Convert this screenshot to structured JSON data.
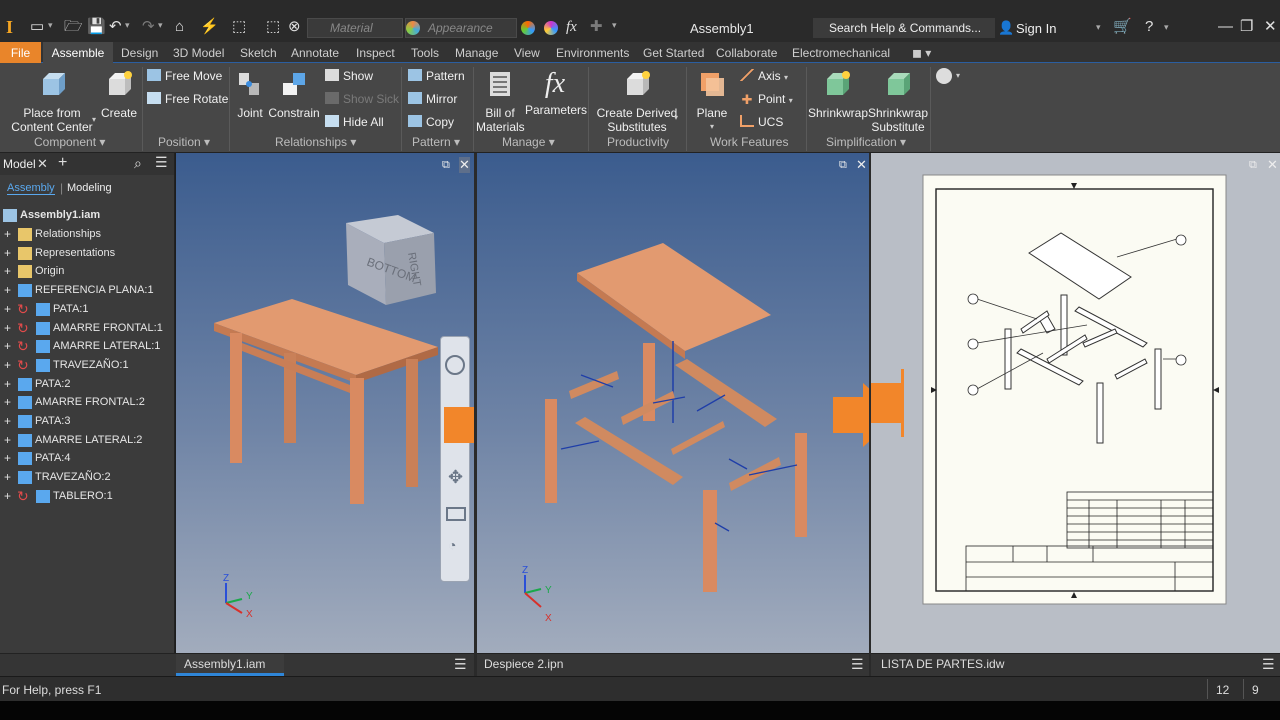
{
  "titlebar": {
    "material_placeholder": "Material",
    "appearance_placeholder": "Appearance",
    "document_title": "Assembly1",
    "search_placeholder": "Search Help & Commands...",
    "sign_in": "Sign In"
  },
  "menu": {
    "items": [
      "File",
      "Assemble",
      "Design",
      "3D Model",
      "Sketch",
      "Annotate",
      "Inspect",
      "Tools",
      "Manage",
      "View",
      "Environments",
      "Get Started",
      "Collaborate",
      "Electromechanical"
    ]
  },
  "ribbon": {
    "component": {
      "place_label": "Place from\nContent Center",
      "create_label": "Create",
      "panel": "Component"
    },
    "position": {
      "free_move": "Free Move",
      "free_rotate": "Free Rotate",
      "panel": "Position"
    },
    "relationships": {
      "joint": "Joint",
      "constrain": "Constrain",
      "show": "Show",
      "show_sick": "Show Sick",
      "hide_all": "Hide All",
      "panel": "Relationships"
    },
    "pattern": {
      "pattern": "Pattern",
      "mirror": "Mirror",
      "copy": "Copy",
      "panel": "Pattern"
    },
    "manage": {
      "bom": "Bill of\nMaterials",
      "parameters": "Parameters",
      "panel": "Manage"
    },
    "productivity": {
      "derived": "Create Derived\nSubstitutes",
      "panel": "Productivity"
    },
    "work_features": {
      "plane": "Plane",
      "axis": "Axis",
      "point": "Point",
      "ucs": "UCS",
      "panel": "Work Features"
    },
    "simplification": {
      "shrinkwrap": "Shrinkwrap",
      "shrinkwrap_sub": "Shrinkwrap\nSubstitute",
      "panel": "Simplification"
    }
  },
  "browser": {
    "tab_model": "Model",
    "sub_assembly": "Assembly",
    "sub_modeling": "Modeling",
    "root": "Assembly1.iam",
    "items": [
      {
        "label": "Relationships",
        "icon": "folder"
      },
      {
        "label": "Representations",
        "icon": "folder"
      },
      {
        "label": "Origin",
        "icon": "folder"
      },
      {
        "label": "REFERENCIA PLANA:1",
        "icon": "part"
      },
      {
        "label": "PATA:1",
        "icon": "part-refresh"
      },
      {
        "label": "AMARRE FRONTAL:1",
        "icon": "part-refresh"
      },
      {
        "label": "AMARRE LATERAL:1",
        "icon": "part-refresh"
      },
      {
        "label": "TRAVEZAÑO:1",
        "icon": "part-refresh"
      },
      {
        "label": "PATA:2",
        "icon": "part"
      },
      {
        "label": "AMARRE FRONTAL:2",
        "icon": "part"
      },
      {
        "label": "PATA:3",
        "icon": "part"
      },
      {
        "label": "AMARRE LATERAL:2",
        "icon": "part"
      },
      {
        "label": "PATA:4",
        "icon": "part"
      },
      {
        "label": "TRAVEZAÑO:2",
        "icon": "part"
      },
      {
        "label": "TABLERO:1",
        "icon": "part-refresh"
      }
    ]
  },
  "viewcube": {
    "face_top": "BOTTOM",
    "face_right": "RIGHT"
  },
  "tabs": {
    "view1": "Assembly1.iam",
    "view2": "Despiece 2.ipn",
    "view3": "LISTA DE PARTES.idw"
  },
  "status": {
    "help": "For Help, press F1",
    "count1": "12",
    "count2": "9"
  },
  "colors": {
    "accent": "#e9852a",
    "wood": "#d9906a",
    "arrow": "#f2862a",
    "selection": "#2f86d8"
  }
}
